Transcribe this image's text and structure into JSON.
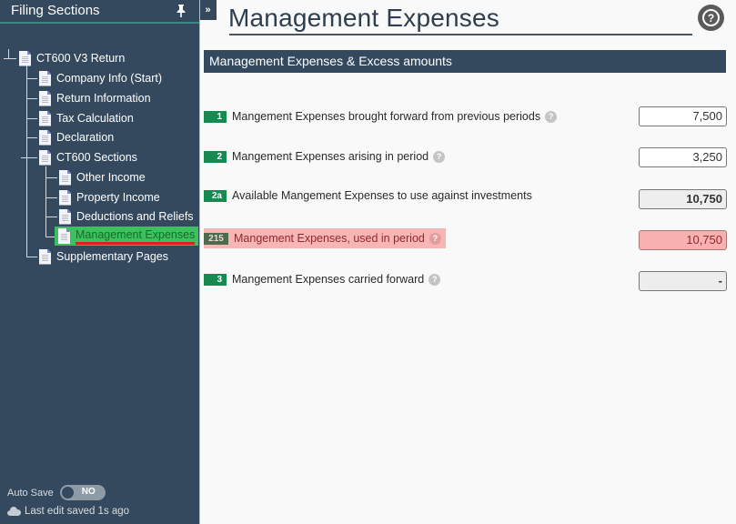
{
  "sidebar": {
    "title": "Filing Sections",
    "pin_icon": "pin-icon",
    "collapse_label": "»",
    "tree": {
      "root": "CT600 V3 Return",
      "items": [
        {
          "label": "Company Info (Start)"
        },
        {
          "label": "Return Information"
        },
        {
          "label": "Tax Calculation"
        },
        {
          "label": "Declaration"
        },
        {
          "label": "CT600 Sections"
        },
        {
          "label": "Supplementary Pages"
        }
      ],
      "ct600_children": [
        {
          "label": "Other Income"
        },
        {
          "label": "Property Income"
        },
        {
          "label": "Deductions and Reliefs"
        },
        {
          "label": "Management Expenses",
          "active": true
        }
      ]
    },
    "autosave": {
      "label": "Auto Save",
      "state": "NO"
    },
    "last_edit": "Last edit saved 1s ago"
  },
  "main": {
    "title": "Management Expenses",
    "help_icon": "?",
    "section_title": "Management Expenses & Excess amounts",
    "rows": [
      {
        "box": "1",
        "label": "Mangement Expenses brought forward from previous periods",
        "help": true,
        "value": "7,500",
        "editable": true
      },
      {
        "box": "2",
        "label": "Mangement Expenses arising in period",
        "help": true,
        "value": "3,250",
        "editable": true
      },
      {
        "box": "2a",
        "label": "Available Mangement Expenses to use against investments",
        "help": false,
        "value": "10,750",
        "editable": false
      },
      {
        "box": "215",
        "label": "Mangement Expenses, used in period",
        "help": true,
        "value": "10,750",
        "editable": true,
        "error": true
      },
      {
        "box": "3",
        "label": "Mangement Expenses carried forward",
        "help": true,
        "value": "-",
        "editable": false
      }
    ],
    "colors": {
      "accent": "#34495e",
      "badge": "#178a52",
      "error": "#f7b5b5",
      "active_nav": "#3cc060"
    }
  }
}
